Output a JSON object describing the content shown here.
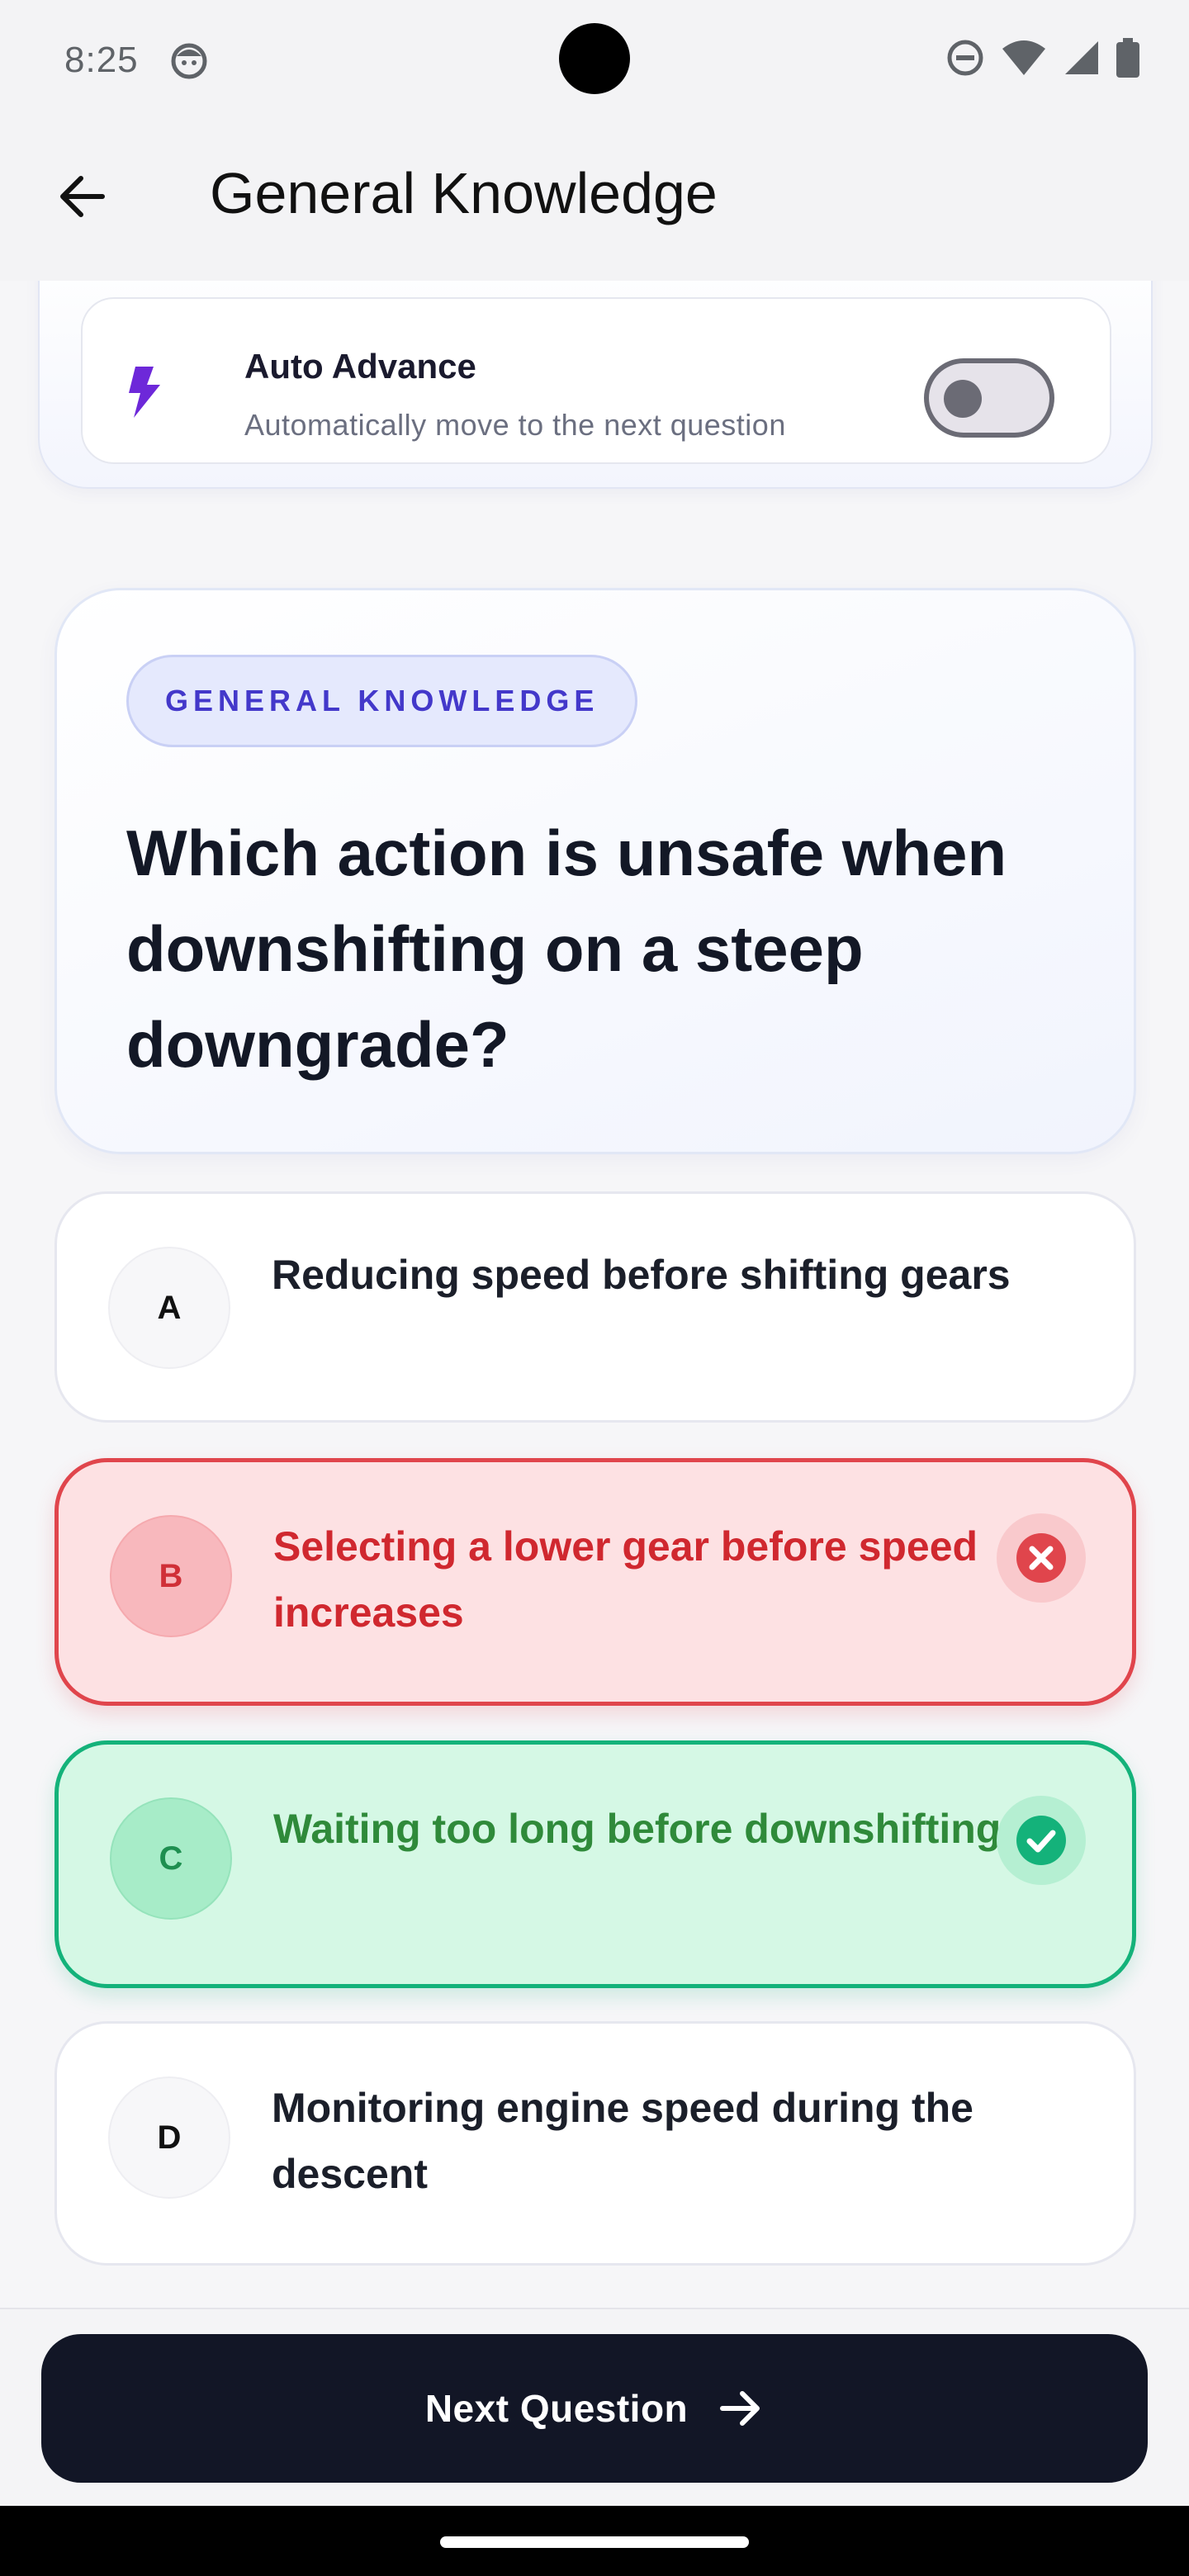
{
  "status_bar": {
    "time": "8:25"
  },
  "app_bar": {
    "title": "General Knowledge"
  },
  "auto_advance": {
    "title": "Auto Advance",
    "subtitle": "Automatically move to the next question",
    "enabled": false
  },
  "question": {
    "category": "GENERAL KNOWLEDGE",
    "text": "Which action is unsafe when downshifting on a steep downgrade?"
  },
  "options": [
    {
      "letter": "A",
      "text": "Reducing speed before shifting gears",
      "state": "neutral"
    },
    {
      "letter": "B",
      "text": "Selecting a lower gear before speed increases",
      "state": "wrong"
    },
    {
      "letter": "C",
      "text": "Waiting too long before downshifting",
      "state": "correct"
    },
    {
      "letter": "D",
      "text": "Monitoring engine speed during the descent",
      "state": "neutral"
    }
  ],
  "footer": {
    "next_label": "Next Question"
  },
  "colors": {
    "accent": "#4338ca",
    "wrong": "#e0454c",
    "correct": "#14b27a",
    "button": "#121626"
  }
}
